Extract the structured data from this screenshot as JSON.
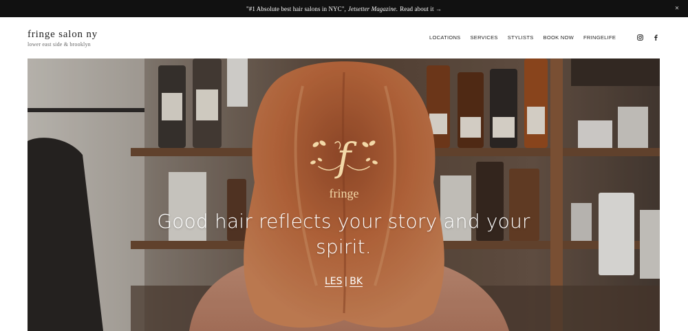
{
  "announcement": {
    "quote": "\"#1 Absolute best hair salons in NYC\",",
    "source": "Jetsetter Magazine.",
    "link_text": "Read about it →",
    "close": "×"
  },
  "brand": {
    "name": "fringe salon ny",
    "tagline": "lower east side & brooklyn"
  },
  "nav": [
    "LOCATIONS",
    "SERVICES",
    "STYLISTS",
    "BOOK NOW",
    "FRINGELIFE"
  ],
  "social": [
    "instagram-icon",
    "facebook-icon"
  ],
  "hero": {
    "logo_word": "fringe",
    "logo_letter": "f",
    "headline_line1": "Good hair reflects your story and your",
    "headline_line2": "spirit.",
    "link_les": "LES",
    "separator": "|",
    "link_bk": "BK"
  },
  "colors": {
    "announce_bg": "#111111",
    "logo_gold": "#f3d9a8",
    "hair": "#b5653a"
  }
}
